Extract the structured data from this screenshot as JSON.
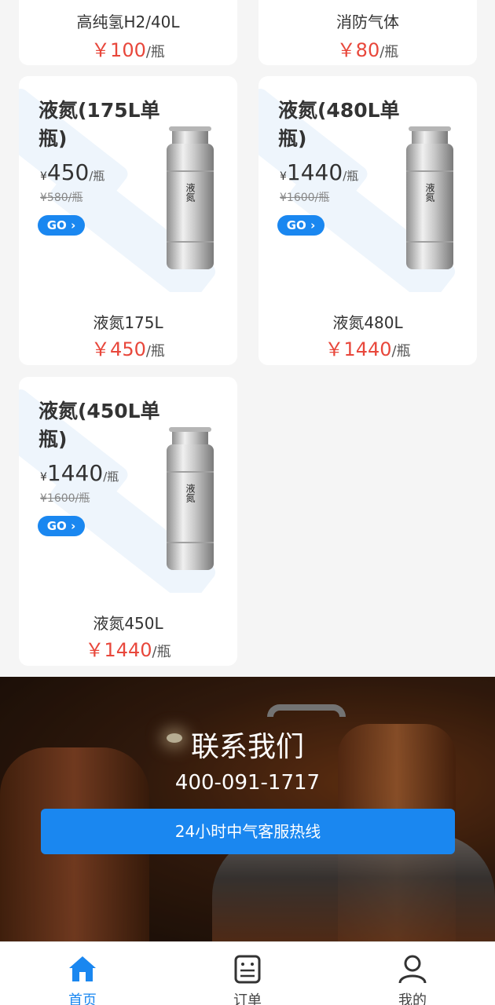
{
  "top_cards": [
    {
      "name": "高纯氢H2/40L",
      "price": "￥100",
      "unit": "/瓶"
    },
    {
      "name": "消防气体",
      "price": "￥80",
      "unit": "/瓶"
    }
  ],
  "products": [
    {
      "banner_title": "液氮(175L单瓶)",
      "yen": "¥",
      "banner_price": "450",
      "unit": "/瓶",
      "old_price": "¥580/瓶",
      "go": "GO",
      "tank_label": "液氮",
      "name": "液氮175L",
      "price": "￥450"
    },
    {
      "banner_title": "液氮(480L单瓶)",
      "yen": "¥",
      "banner_price": "1440",
      "unit": "/瓶",
      "old_price": "¥1600/瓶",
      "go": "GO",
      "tank_label": "液氮",
      "name": "液氮480L",
      "price": "￥1440"
    },
    {
      "banner_title": "液氮(450L单瓶)",
      "yen": "¥",
      "banner_price": "1440",
      "unit": "/瓶",
      "old_price": "¥1600/瓶",
      "go": "GO",
      "tank_label": "液氮",
      "name": "液氮450L",
      "price": "￥1440"
    }
  ],
  "contact": {
    "title": "联系我们",
    "phone": "400-091-1717",
    "hotline": "24小时中气客服热线"
  },
  "tabbar": {
    "home": "首页",
    "orders": "订单",
    "mine": "我的"
  },
  "colors": {
    "accent": "#1a87f0",
    "price": "#e8473b"
  },
  "icons": [
    "home-icon",
    "order-icon",
    "user-icon",
    "chevron-right-icon"
  ]
}
